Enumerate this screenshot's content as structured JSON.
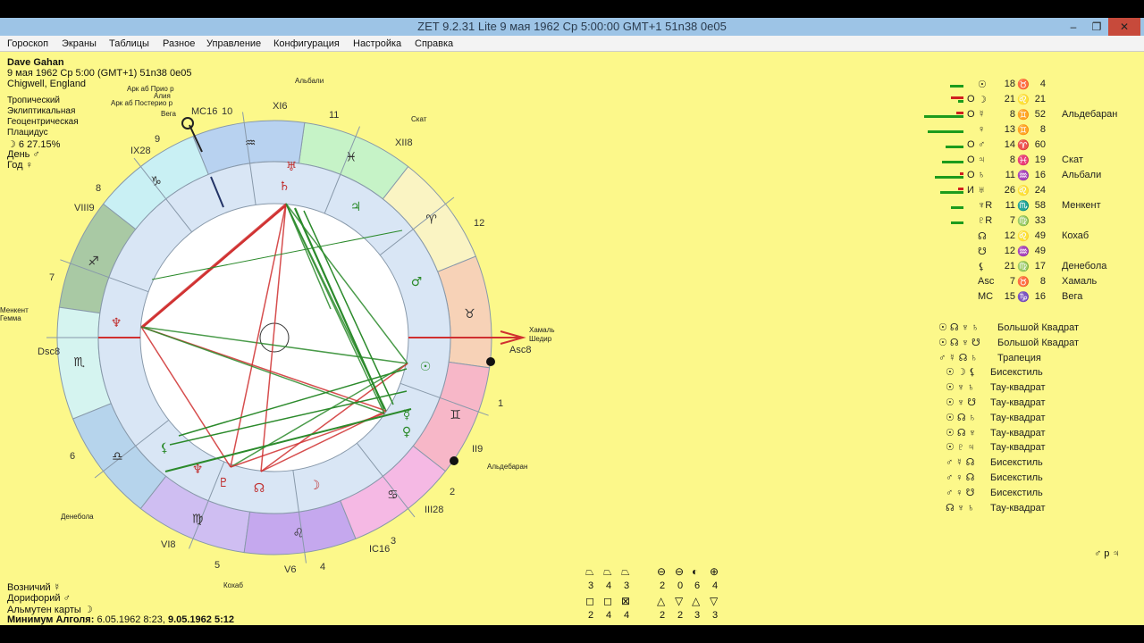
{
  "window": {
    "title": "ZET 9.2.31 Lite     9 мая 1962  Ср     5:00:00 GMT+1 51n38  0e05",
    "min": "–",
    "max": "❐",
    "close": "✕"
  },
  "menu": [
    "Гороскоп",
    "Экраны",
    "Таблицы",
    "Разное",
    "Управление",
    "Конфигурация",
    "Настройка",
    "Справка"
  ],
  "person": {
    "name": "Dave Gahan",
    "date": "9 мая 1962  Ср    5:00 (GMT+1)  51n38  0e05",
    "place": "Chigwell, England"
  },
  "settings": [
    "Тропический",
    "Эклиптикальная",
    "Геоцентрическая",
    "Плацидус"
  ],
  "moon_phase": "☽  6 27.15%",
  "day_label": "День ♂",
  "year_label": "Год ♀",
  "chart_labels": {
    "stars": [
      "Арк аб Прио р",
      "Алия",
      "Арк аб Постерио р",
      "Вега",
      "Альбали",
      "Скат",
      "Хамаль",
      "Шедир",
      "Альдебаран",
      "Денебола",
      "Кохаб",
      "Менкент",
      "Гемма"
    ],
    "houses": [
      "MC16",
      "XI6",
      "XII8",
      "Asc8",
      "II9",
      "III28",
      "IC16",
      "V6",
      "VI8",
      "Dsc8",
      "VIII9",
      "IX28"
    ],
    "house_numbers": [
      "10",
      "11",
      "12",
      "1",
      "2",
      "3",
      "4",
      "5",
      "6",
      "7",
      "8",
      "9"
    ]
  },
  "planets": [
    {
      "glyph": "☉",
      "sign": "♉",
      "deg": "18",
      "min": "4",
      "mark": "",
      "star": ""
    },
    {
      "glyph": "☽",
      "sign": "♌",
      "deg": "21",
      "min": "21",
      "mark": "О",
      "star": ""
    },
    {
      "glyph": "☿",
      "sign": "♊",
      "deg": "8",
      "min": "52",
      "mark": "О",
      "star": "Альдебаран"
    },
    {
      "glyph": "♀",
      "sign": "♊",
      "deg": "13",
      "min": "8",
      "mark": "",
      "star": ""
    },
    {
      "glyph": "♂",
      "sign": "♈",
      "deg": "14",
      "min": "60",
      "mark": "О",
      "star": ""
    },
    {
      "glyph": "♃",
      "sign": "♓",
      "deg": "8",
      "min": "19",
      "mark": "О",
      "star": "Скат"
    },
    {
      "glyph": "♄",
      "sign": "♒",
      "deg": "11",
      "min": "16",
      "mark": "О",
      "star": "Альбали"
    },
    {
      "glyph": "♅",
      "sign": "♌",
      "deg": "26",
      "min": "24",
      "mark": "И",
      "star": ""
    },
    {
      "glyph": "♆R",
      "sign": "♏",
      "deg": "11",
      "min": "58",
      "mark": "",
      "star": "Менкент"
    },
    {
      "glyph": "♇R",
      "sign": "♍",
      "deg": "7",
      "min": "33",
      "mark": "",
      "star": ""
    },
    {
      "glyph": "☊",
      "sign": "♌",
      "deg": "12",
      "min": "49",
      "mark": "",
      "star": "Кохаб"
    },
    {
      "glyph": "☋",
      "sign": "♒",
      "deg": "12",
      "min": "49",
      "mark": "",
      "star": ""
    },
    {
      "glyph": "⚸",
      "sign": "♍",
      "deg": "21",
      "min": "17",
      "mark": "",
      "star": "Денебола"
    },
    {
      "glyph": "Asc",
      "sign": "♉",
      "deg": "7",
      "min": "8",
      "mark": "",
      "star": "Хамаль"
    },
    {
      "glyph": "MC",
      "sign": "♑",
      "deg": "15",
      "min": "16",
      "mark": "",
      "star": "Вега"
    }
  ],
  "configurations": [
    {
      "glyphs": "☉ ☊ ♆ ♄",
      "name": "Большой Квадрат"
    },
    {
      "glyphs": "☉ ☊ ♆ ☋",
      "name": "Большой Квадрат"
    },
    {
      "glyphs": "♂ ☿ ☊ ♄",
      "name": "Трапеция"
    },
    {
      "glyphs": "☉ ☽ ⚸",
      "name": "Бисекстиль"
    },
    {
      "glyphs": "☉ ♆ ♄",
      "name": "Тау-квадрат"
    },
    {
      "glyphs": "☉ ♆ ☋",
      "name": "Тау-квадрат"
    },
    {
      "glyphs": "☉ ☊ ♄",
      "name": "Тау-квадрат"
    },
    {
      "glyphs": "☉ ☊ ♆",
      "name": "Тау-квадрат"
    },
    {
      "glyphs": "☉ ♇ ♃",
      "name": "Тау-квадрат"
    },
    {
      "glyphs": "♂ ☿ ☊",
      "name": "Бисекстиль"
    },
    {
      "glyphs": "♂ ♀ ☊",
      "name": "Бисекстиль"
    },
    {
      "glyphs": "♂ ♀ ☋",
      "name": "Бисекстиль"
    },
    {
      "glyphs": "☊ ♆ ♄",
      "name": "Тау-квадрат"
    }
  ],
  "mars_jupiter": "♂ р ♃",
  "aspect_counts": {
    "top_icons": [
      "⏢",
      "⏢",
      "⏢",
      "⊖",
      "⊖",
      "◐",
      "⊕"
    ],
    "top_numbers": [
      "3",
      "4",
      "3",
      "2",
      "0",
      "6",
      "4"
    ],
    "bottom_icons": [
      "◻",
      "◻",
      "⊠",
      "△",
      "▽",
      "△",
      "▽"
    ],
    "bottom_numbers": [
      "2",
      "4",
      "4",
      "2",
      "2",
      "3",
      "3"
    ]
  },
  "bottom_left": {
    "charioteer": "Возничий  ☿",
    "doryphory": "Дорифорий  ♂",
    "almuten": "Альмутен карты  ☽",
    "algol_label": "Минимум Алголя:",
    "algol_1": "6.05.1962  8:23,",
    "algol_2": "9.05.1962  5:12"
  }
}
